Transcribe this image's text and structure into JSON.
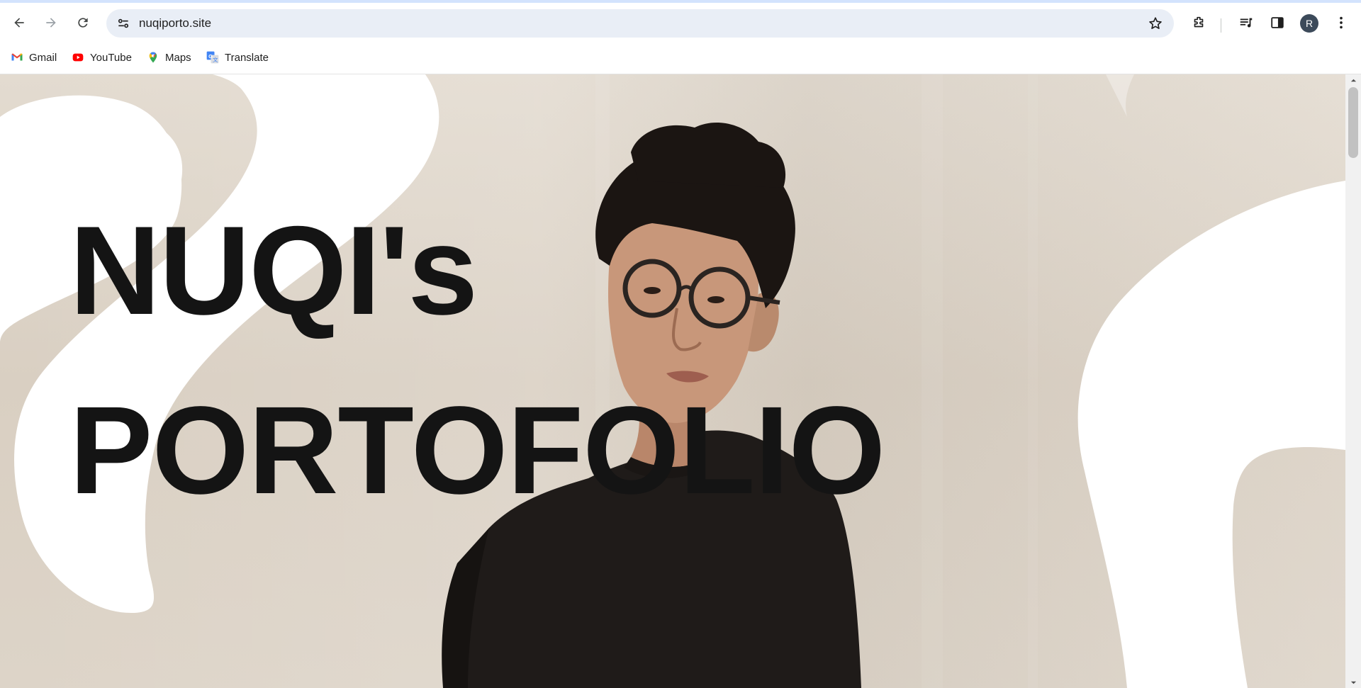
{
  "browser": {
    "url": "nuqiporto.site",
    "avatar_initial": "R",
    "icons": {
      "back": "arrow-left-icon",
      "forward": "arrow-right-icon",
      "reload": "reload-icon",
      "site_info": "tune-icon",
      "bookmark_star": "star-icon",
      "extensions": "puzzle-icon",
      "media": "media-queue-icon",
      "side_panel": "side-panel-icon",
      "menu": "kebab-menu-icon"
    }
  },
  "bookmarks": [
    {
      "label": "Gmail",
      "icon": "gmail-icon"
    },
    {
      "label": "YouTube",
      "icon": "youtube-icon"
    },
    {
      "label": "Maps",
      "icon": "maps-pin-icon"
    },
    {
      "label": "Translate",
      "icon": "translate-icon"
    }
  ],
  "hero": {
    "line1": "NUQI's",
    "line2": "PORTOFOLIO"
  },
  "colors": {
    "omnibox_bg": "#e9eef6",
    "title_text": "#141414",
    "wall": "#ddd3c6",
    "shirt": "#1f1b19"
  }
}
